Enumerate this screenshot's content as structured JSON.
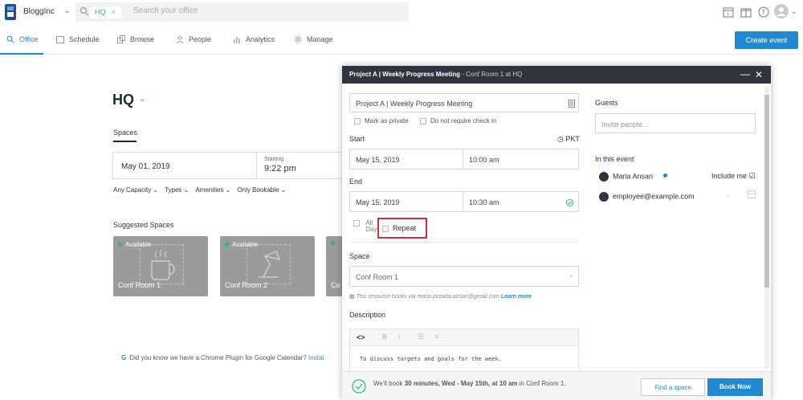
{
  "app": {
    "brand": "BloggInc"
  },
  "search": {
    "chip": "HQ",
    "placeholder": "Search your office"
  },
  "nav": {
    "items": [
      "Office",
      "Schedule",
      "Browse",
      "People",
      "Analytics",
      "Manage"
    ],
    "create_button": "Create event"
  },
  "office": {
    "title": "HQ",
    "tab": "Spaces",
    "date": "May 01, 2019",
    "starting_label": "Starting",
    "starting_value": "9:22 pm",
    "filters": [
      "Any Capacity",
      "Types",
      "Amenities",
      "Only Bookable"
    ],
    "suggested_title": "Suggested Spaces",
    "cards": [
      {
        "status": "Available",
        "name": "Conf Room 1"
      },
      {
        "status": "Available",
        "name": "Conf Room 2"
      },
      {
        "status": "",
        "name": "Co"
      }
    ],
    "tip_prefix": "G",
    "tip": "Did you know we have a Chrome Plugin for Google Calendar?",
    "tip_link": "Instal"
  },
  "modal": {
    "title": "Project A | Weekly Progress Meeting",
    "subtitle": " - Conf Room 1 at HQ",
    "event_name": "Project A | Weekly Progress Meeting",
    "mark_private": "Mark as private",
    "no_checkin": "Do not require check in",
    "start_label": "Start",
    "timezone": "PKT",
    "start_date": "May 15, 2019",
    "start_time": "10:00 am",
    "end_label": "End",
    "end_date": "May 15, 2019",
    "end_time": "10:30 am",
    "all_day": "All Day",
    "repeat": "Repeat",
    "space_label": "Space",
    "space_value": "Conf Room 1",
    "books_via": "This resource books via maria.pirzada.ansari@gmail.com",
    "learn_more": "Learn more",
    "description_label": "Description",
    "description_text": "To discuss targets and goals for the week.",
    "guests_label": "Guests",
    "guests_placeholder": "Invite people...",
    "in_event_label": "In this event",
    "attendees": [
      {
        "name": "Maria Ansari",
        "extra": "Include me"
      },
      {
        "name": "employee@example.com",
        "extra": ""
      }
    ],
    "footer_prefix": "We'll book ",
    "footer_bold": "30 minutes, Wed - May 15th, at 10 am",
    "footer_suffix": " in Conf Room 1.",
    "find_space": "Find a space",
    "book_now": "Book Now"
  },
  "colors": {
    "accent": "#1f8ad2",
    "available": "#2eb85c",
    "highlight": "#d0303a"
  }
}
